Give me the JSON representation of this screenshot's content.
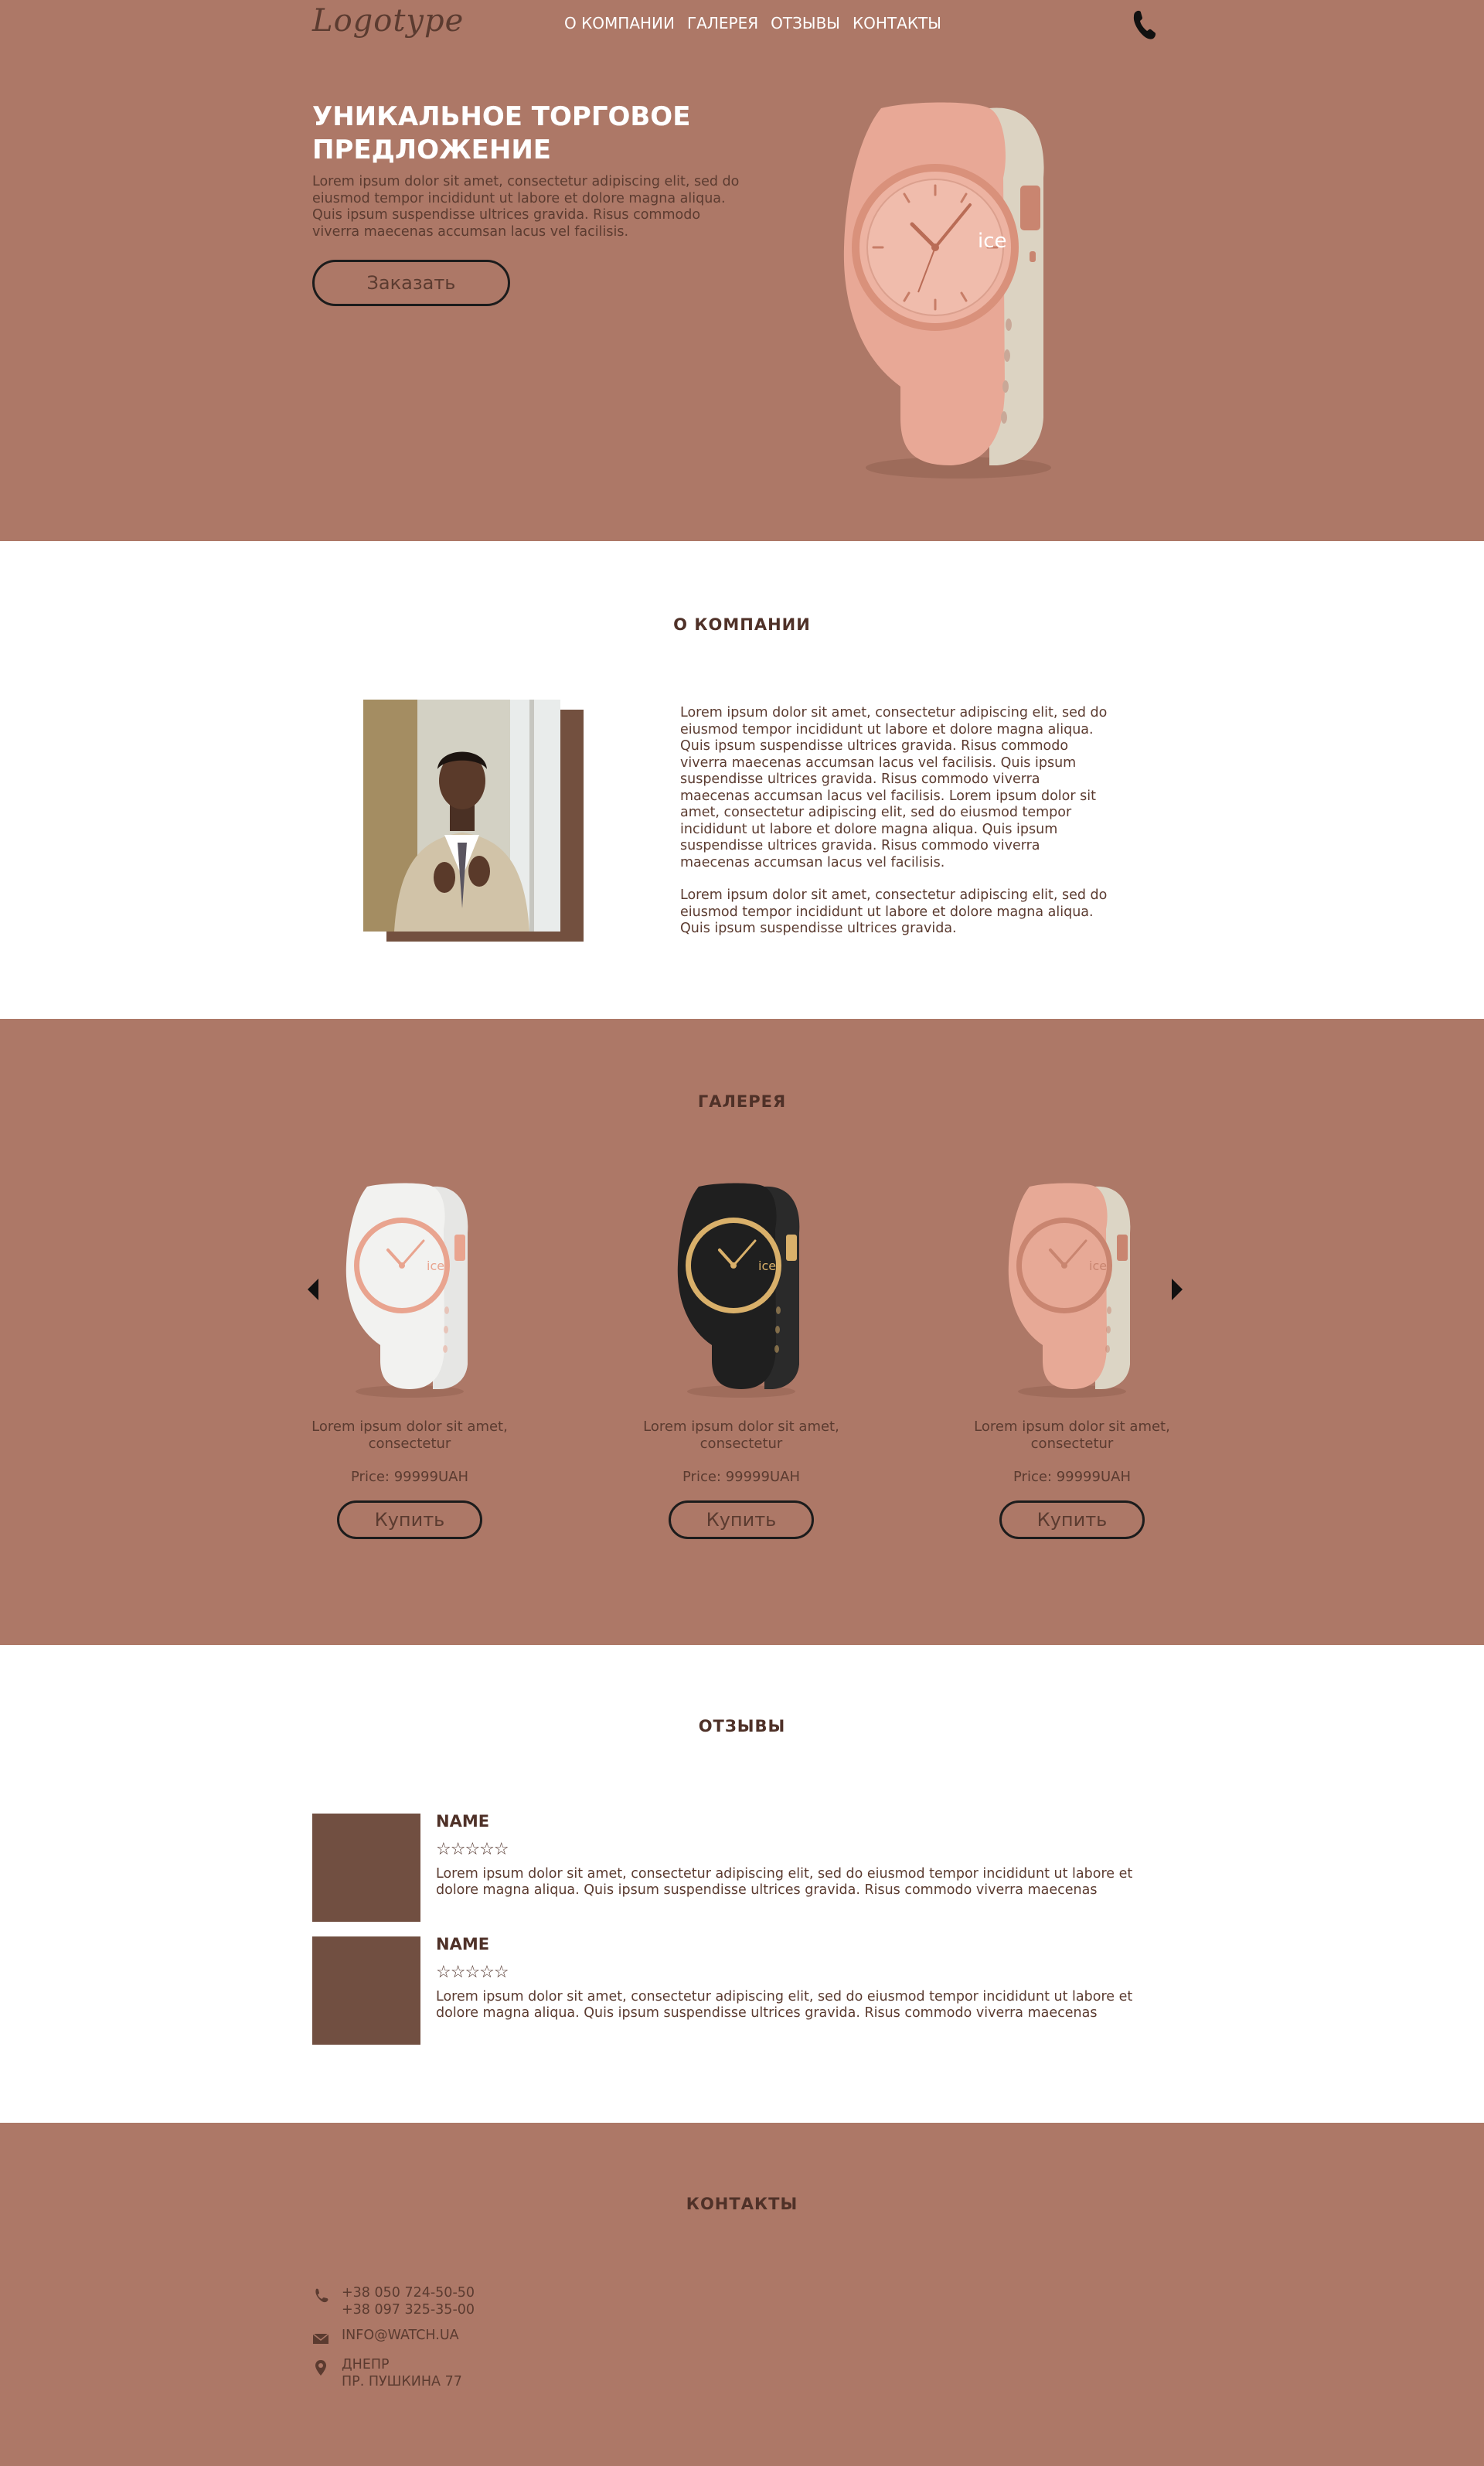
{
  "header": {
    "logo": "Logotype",
    "nav": [
      "О КОМПАНИИ",
      "ГАЛЕРЕЯ",
      "ОТЗЫВЫ",
      "КОНТАКТЫ"
    ],
    "phone_icon": "phone-icon"
  },
  "hero": {
    "title": "УНИКАЛЬНОЕ ТОРГОВОЕ ПРЕДЛОЖЕНИЕ",
    "text": "Lorem ipsum dolor sit amet, consectetur adipiscing elit, sed do eiusmod tempor incididunt ut labore et dolore magna aliqua. Quis ipsum suspendisse ultrices gravida. Risus commodo viverra maecenas accumsan lacus vel facilisis.",
    "button": "Заказать",
    "watch_brand": "ice"
  },
  "about": {
    "title": "О КОМПАНИИ",
    "paragraphs": [
      "Lorem ipsum dolor sit amet, consectetur adipiscing elit, sed do eiusmod tempor incididunt ut labore et dolore magna aliqua. Quis ipsum suspendisse ultrices gravida. Risus commodo viverra maecenas accumsan lacus vel facilisis. Quis ipsum suspendisse ultrices gravida. Risus commodo viverra maecenas accumsan lacus vel facilisis. Lorem ipsum dolor sit amet, consectetur adipiscing elit, sed do eiusmod tempor incididunt ut labore et dolore magna aliqua. Quis ipsum suspendisse ultrices gravida. Risus commodo viverra maecenas accumsan lacus vel facilisis.",
      "Lorem ipsum dolor sit amet, consectetur adipiscing elit, sed do eiusmod tempor incididunt ut labore et dolore magna aliqua. Quis ipsum suspendisse ultrices gravida."
    ]
  },
  "gallery": {
    "title": "ГАЛЕРЕЯ",
    "prev_icon": "arrow-left-icon",
    "next_icon": "arrow-right-icon",
    "items": [
      {
        "desc": "Lorem ipsum dolor sit amet, consectetur",
        "price": "Price: 99999UAH",
        "button": "Купить",
        "color": "#f2f2f0",
        "strap": "#e6e6e4",
        "accent": "#e9a48f",
        "brand": "ice"
      },
      {
        "desc": "Lorem ipsum dolor sit amet, consectetur",
        "price": "Price: 99999UAH",
        "button": "Купить",
        "color": "#1f1f1f",
        "strap": "#2a2a2a",
        "accent": "#d9b06a",
        "brand": "ice"
      },
      {
        "desc": "Lorem ipsum dolor sit amet, consectetur",
        "price": "Price: 99999UAH",
        "button": "Купить",
        "color": "#e7a996",
        "strap": "#dcd5c5",
        "accent": "#c98570",
        "brand": "ice"
      }
    ]
  },
  "reviews": {
    "title": "ОТЗЫВЫ",
    "items": [
      {
        "name": "NAME",
        "stars": "☆☆☆☆☆",
        "text": "Lorem ipsum dolor sit amet, consectetur adipiscing elit, sed do eiusmod tempor incididunt ut labore et dolore magna aliqua. Quis ipsum suspendisse ultrices gravida. Risus commodo viverra maecenas"
      },
      {
        "name": "NAME",
        "stars": "☆☆☆☆☆",
        "text": "Lorem ipsum dolor sit amet, consectetur adipiscing elit, sed do eiusmod tempor incididunt ut labore et dolore magna aliqua. Quis ipsum suspendisse ultrices gravida. Risus commodo viverra maecenas"
      }
    ]
  },
  "contacts": {
    "title": "КОНТАКТЫ",
    "phones": [
      "+38 050 724-50-50",
      "+38 097 325-35-00"
    ],
    "email": "INFO@WATCH.UA",
    "address": [
      "ДНЕПР",
      "ПР. ПУШКИНА 77"
    ]
  },
  "colors": {
    "brand_bg": "#ad7867",
    "dark_brown": "#4f3128",
    "avatar": "#714f41",
    "white": "#ffffff"
  }
}
